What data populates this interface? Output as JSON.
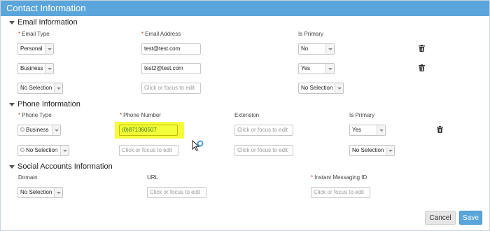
{
  "title": "Contact Information",
  "email": {
    "section_title": "Email Information",
    "col_type": "Email Type",
    "col_address": "Email Address",
    "col_primary": "Is Primary",
    "rows": [
      {
        "type": "Personal",
        "address": "test@test.com",
        "primary": "No"
      },
      {
        "type": "Business",
        "address": "test2@test.com",
        "primary": "Yes"
      },
      {
        "type": "No Selection",
        "address_placeholder": "Click or focus to edit",
        "primary": "No Selection"
      }
    ]
  },
  "phone": {
    "section_title": "Phone Information",
    "col_type": "Phone Type",
    "col_number": "Phone Number",
    "col_extension": "Extension",
    "col_primary": "Is Primary",
    "rows": [
      {
        "type": "Business",
        "number": "(0)871360507",
        "extension_placeholder": "Click or focus to edit",
        "primary": "Yes"
      },
      {
        "type": "No Selection",
        "number_placeholder": "Click or focus to edit",
        "extension_placeholder": "Click or focus to edit",
        "primary": "No Selection"
      }
    ]
  },
  "social": {
    "section_title": "Social Accounts Information",
    "col_domain": "Domain",
    "col_url": "URL",
    "col_im": "Instant Messaging ID",
    "rows": [
      {
        "domain": "No Selection",
        "url_placeholder": "Click or focus to edit",
        "im_placeholder": "Click or focus to edit"
      }
    ]
  },
  "buttons": {
    "cancel": "Cancel",
    "save": "Save"
  },
  "colors": {
    "accent": "#5aa5da",
    "highlight": "#f6fb3c",
    "required": "#c0392b"
  }
}
